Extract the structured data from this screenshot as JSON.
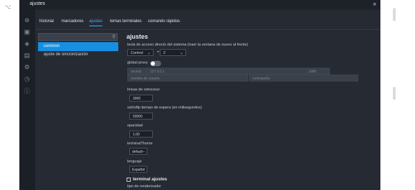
{
  "sidebar_icons": [
    "plus-circle-icon",
    "folder-icon",
    "bookmark-icon",
    "terminal-icon",
    "settings-icon",
    "history-icon",
    "info-icon"
  ],
  "window": {
    "title": "ajustes",
    "close": "×"
  },
  "tabs": [
    {
      "label": "historial"
    },
    {
      "label": "marcadores"
    },
    {
      "label": "ajustes"
    },
    {
      "label": "temas terminales"
    },
    {
      "label": "comando rápidos"
    }
  ],
  "search": {
    "placeholder": ""
  },
  "nav": {
    "active": "common",
    "second": "ajuste de sincronización"
  },
  "main": {
    "title": "ajustes",
    "hotkey_label": "tecla de acceso directo del sistema (traer la ventana de nuevo al frente)",
    "hotkey_modifier": "Control",
    "hotkey_plus": "+",
    "hotkey_key": "2",
    "proxy_label": "global proxy",
    "proxy_protocol": "socks5",
    "proxy_host": "127.0.0.1",
    "proxy_port": "1080",
    "proxy_user_placeholder": "nombre de usuario",
    "proxy_pass_placeholder": "contraseña",
    "scrollback_label": "líneas de retroceso",
    "scrollback_value": "3000",
    "timeout_label": "ssh/sftp tiempo de espera (en milisegundos)",
    "timeout_value": "50000",
    "opacity_label": "opacidad",
    "opacity_value": "1.00",
    "theme_label": "terminalTheme",
    "theme_value": "default",
    "language_label": "lenguaje",
    "language_value": "Español",
    "terminal_section": "terminal ajustes",
    "renderer_label": "tipo de renderizador"
  }
}
